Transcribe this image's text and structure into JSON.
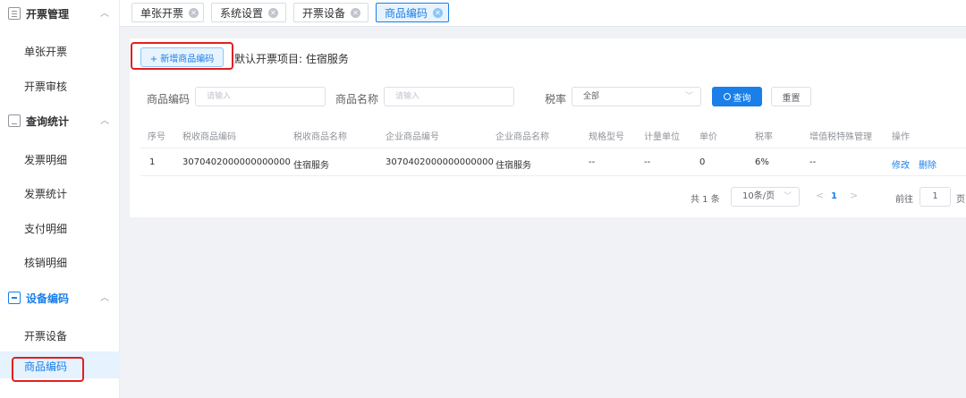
{
  "sidebar": {
    "groups": [
      {
        "label": "开票管理",
        "icon": "document-icon",
        "items": [
          "单张开票",
          "开票审核"
        ]
      },
      {
        "label": "查询统计",
        "icon": "monitor-icon",
        "items": [
          "发票明细",
          "发票统计",
          "支付明细",
          "核销明细"
        ]
      },
      {
        "label": "设备编码",
        "icon": "device-icon",
        "items": [
          "开票设备",
          "商品编码"
        ]
      }
    ],
    "active_item": "商品编码"
  },
  "tabs": [
    {
      "label": "单张开票",
      "active": false
    },
    {
      "label": "系统设置",
      "active": false
    },
    {
      "label": "开票设备",
      "active": false
    },
    {
      "label": "商品编码",
      "active": true
    }
  ],
  "toolbar": {
    "add_button": "+ 新增商品编码",
    "default_project": "默认开票项目: 住宿服务"
  },
  "filters": {
    "code_label": "商品编码",
    "code_placeholder": "请输入",
    "name_label": "商品名称",
    "name_placeholder": "请输入",
    "tax_label": "税率",
    "tax_value": "全部",
    "query_button": "查询",
    "reset_button": "重置"
  },
  "table": {
    "headers": [
      "序号",
      "税收商品编码",
      "税收商品名称",
      "企业商品编号",
      "企业商品名称",
      "规格型号",
      "计量单位",
      "单价",
      "税率",
      "增值税特殊管理",
      "操作"
    ],
    "rows": [
      {
        "index": "1",
        "tax_code": "3070402000000000000",
        "tax_name": "住宿服务",
        "ent_code": "3070402000000000000",
        "ent_name": "住宿服务",
        "spec": "--",
        "unit": "--",
        "price": "0",
        "rate": "6%",
        "special": "--",
        "edit": "修改",
        "delete": "删除"
      }
    ]
  },
  "pagination": {
    "total": "共 1 条",
    "page_size": "10条/页",
    "prev": "<",
    "current": "1",
    "next": ">",
    "goto_label": "前往",
    "goto_value": "1",
    "page_suffix": "页"
  },
  "colors": {
    "accent": "#1a7fe8",
    "highlight": "#e02020"
  }
}
